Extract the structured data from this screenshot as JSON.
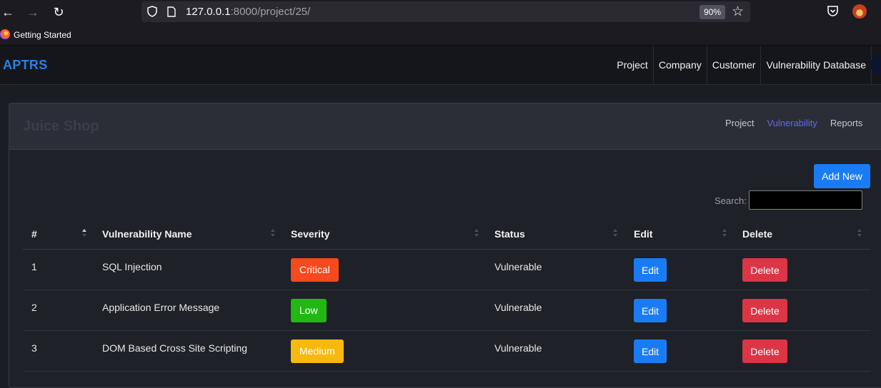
{
  "browser": {
    "url_host": "127.0.0.1",
    "url_rest": ":8000/project/25/",
    "zoom": "90%",
    "bookmarks": [
      {
        "label": "Getting Started"
      }
    ]
  },
  "navbar": {
    "brand": "APTRS",
    "links": [
      {
        "label": "Project"
      },
      {
        "label": "Company"
      },
      {
        "label": "Customer"
      },
      {
        "label": "Vulnerability Database"
      }
    ]
  },
  "card": {
    "title": "Juice Shop",
    "tabs": [
      {
        "label": "Project",
        "active": false
      },
      {
        "label": "Vulnerability",
        "active": true
      },
      {
        "label": "Reports",
        "active": false
      }
    ],
    "add_new_label": "Add New",
    "search_label": "Search:",
    "search_value": ""
  },
  "table": {
    "columns": [
      "#",
      "Vulnerability Name",
      "Severity",
      "Status",
      "Edit",
      "Delete"
    ],
    "rows": [
      {
        "num": "1",
        "name": "SQL Injection",
        "severity": "Critical",
        "severity_color": "#f5491e",
        "status": "Vulnerable",
        "edit": "Edit",
        "delete": "Delete"
      },
      {
        "num": "2",
        "name": "Application Error Message",
        "severity": "Low",
        "severity_color": "#22b814",
        "status": "Vulnerable",
        "edit": "Edit",
        "delete": "Delete"
      },
      {
        "num": "3",
        "name": "DOM Based Cross Site Scripting",
        "severity": "Medium",
        "severity_color": "#f7b90f",
        "status": "Vulnerable",
        "edit": "Edit",
        "delete": "Delete"
      }
    ]
  }
}
